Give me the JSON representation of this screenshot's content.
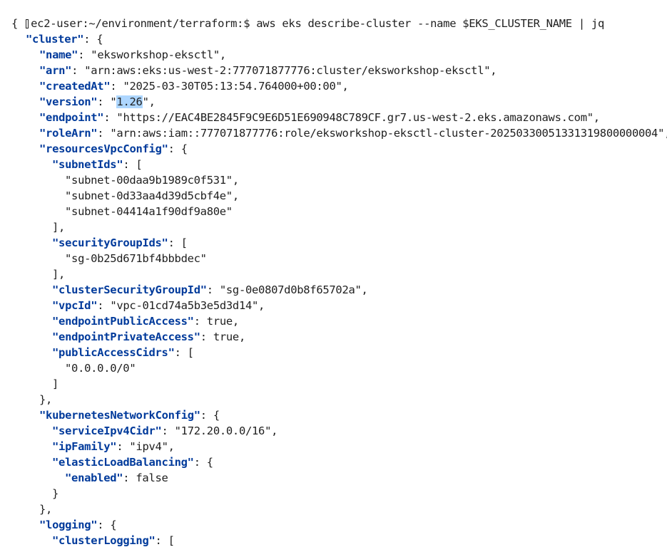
{
  "prompt": "ec2-user:~/environment/terraform:$ aws eks describe-cluster --name $EKS_CLUSTER_NAME | jq",
  "output": {
    "open_brace": "{",
    "cluster_key": "\"cluster\"",
    "name_key": "\"name\"",
    "name_val": "\"eksworkshop-eksctl\"",
    "arn_key": "\"arn\"",
    "arn_val": "\"arn:aws:eks:us-west-2:777071877776:cluster/eksworkshop-eksctl\"",
    "createdAt_key": "\"createdAt\"",
    "createdAt_val": "\"2025-03-30T05:13:54.764000+00:00\"",
    "version_key": "\"version\"",
    "version_q1": "\"",
    "version_sel": "1.26",
    "version_q2": "\"",
    "endpoint_key": "\"endpoint\"",
    "endpoint_val": "\"https://EAC4BE2845F9C9E6D51E690948C789CF.gr7.us-west-2.eks.amazonaws.com\"",
    "roleArn_key": "\"roleArn\"",
    "roleArn_val": "\"arn:aws:iam::777071877776:role/eksworkshop-eksctl-cluster-20250330051331319800000004\"",
    "rvc_key": "\"resourcesVpcConfig\"",
    "subnetIds_key": "\"subnetIds\"",
    "subnet1": "\"subnet-00daa9b1989c0f531\"",
    "subnet2": "\"subnet-0d33aa4d39d5cbf4e\"",
    "subnet3": "\"subnet-04414a1f90df9a80e\"",
    "sgIds_key": "\"securityGroupIds\"",
    "sg1": "\"sg-0b25d671bf4bbbdec\"",
    "csg_key": "\"clusterSecurityGroupId\"",
    "csg_val": "\"sg-0e0807d0b8f65702a\"",
    "vpcId_key": "\"vpcId\"",
    "vpcId_val": "\"vpc-01cd74a5b3e5d3d14\"",
    "epa_key": "\"endpointPublicAccess\"",
    "epa_val": "true",
    "eprv_key": "\"endpointPrivateAccess\"",
    "eprv_val": "true",
    "pac_key": "\"publicAccessCidrs\"",
    "pac1": "\"0.0.0.0/0\"",
    "knc_key": "\"kubernetesNetworkConfig\"",
    "sic_key": "\"serviceIpv4Cidr\"",
    "sic_val": "\"172.20.0.0/16\"",
    "ipf_key": "\"ipFamily\"",
    "ipf_val": "\"ipv4\"",
    "elb_key": "\"elasticLoadBalancing\"",
    "enabled_key": "\"enabled\"",
    "enabled_val": "false",
    "logging_key": "\"logging\"",
    "clusterLogging_key": "\"clusterLogging\""
  }
}
